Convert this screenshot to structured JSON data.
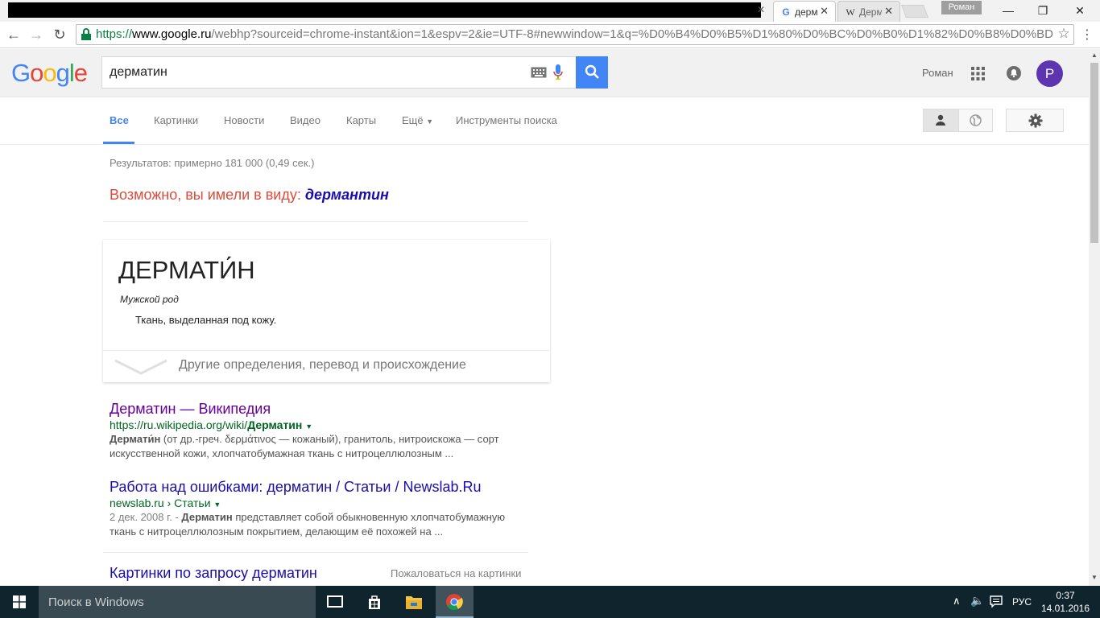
{
  "browser": {
    "tabs": [
      {
        "label": "дерм",
        "icon": "G",
        "active": true
      },
      {
        "label": "Дерм",
        "icon": "W",
        "active": false
      }
    ],
    "profile_name": "Роман",
    "url_scheme": "https://",
    "url_host": "www.google.ru",
    "url_path": "/webhp?sourceid=chrome-instant&ion=1&espv=2&ie=UTF-8#newwindow=1&q=%D0%B4%D0%B5%D1%80%D0%BC%D0%B0%D1%82%D0%B8%D0%BD"
  },
  "google": {
    "logo": "Google",
    "query": "дерматин",
    "user_name": "Роман",
    "avatar_letter": "Р"
  },
  "nav": {
    "tabs": [
      "Все",
      "Картинки",
      "Новости",
      "Видео",
      "Карты",
      "Ещё",
      "Инструменты поиска"
    ],
    "active_index": 0
  },
  "results": {
    "stats": "Результатов: примерно 181 000 (0,49 сек.)",
    "did_you_mean_prefix": "Возможно, вы имели в виду:",
    "did_you_mean_word": "дермантин",
    "dictionary": {
      "word": "ДЕРМАТИ́Н",
      "gender": "Мужской род",
      "definition": "Ткань, выделанная под кожу.",
      "more": "Другие определения, перевод и происхождение"
    },
    "items": [
      {
        "title": "Дерматин — Википедия",
        "url_prefix": "https://ru.wikipedia.org/wiki/",
        "url_bold": "Дерматин",
        "snippet_bold": "Дермати́н",
        "snippet_line1": " (от др.-греч. δερμάτινος — кожаный), гранитоль, нитроискожа — сорт",
        "snippet_line2": "искусственной кожи, хлопчатобумажная ткань с нитроцеллюлозным ..."
      },
      {
        "title": "Работа над ошибками: дерматин / Статьи / Newslab.Ru",
        "url_prefix": "newslab.ru › Статьи",
        "date": "2 дек. 2008 г. - ",
        "snippet_bold": "Дерматин",
        "snippet_line1": " представляет собой обыкновенную хлопчатобумажную",
        "snippet_line2": "ткань с нитроцеллюлозным покрытием, делающим её похожей на ..."
      }
    ],
    "images_title": "Картинки по запросу дерматин",
    "images_report": "Пожаловаться на картинки"
  },
  "taskbar": {
    "search_placeholder": "Поиск в Windows",
    "lang": "РУС",
    "time": "0:37",
    "date": "14.01.2016"
  }
}
